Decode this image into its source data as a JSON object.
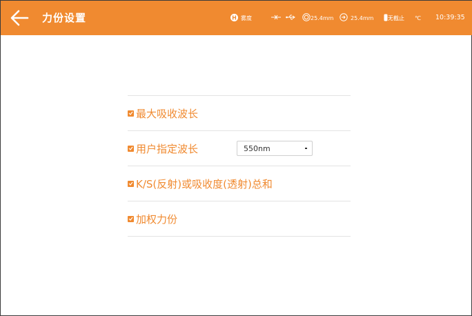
{
  "header": {
    "title": "力份设置",
    "status": {
      "h_badge": "H",
      "mode_text": "雾度",
      "aperture_1": "25.4mm",
      "aperture_2": "25.4mm",
      "trap_text": "无截止",
      "temp_unit": "℃",
      "time": "10:39:35"
    }
  },
  "settings": {
    "items": [
      {
        "label": "最大吸收波长",
        "checked": true
      },
      {
        "label": "用户指定波长",
        "checked": true
      },
      {
        "label": "K/S(反射)或吸收度(透射)总和",
        "checked": true
      },
      {
        "label": "加权力份",
        "checked": true
      }
    ],
    "wavelength_select": {
      "value": "550nm"
    }
  },
  "colors": {
    "accent": "#f08a30",
    "divider": "#e3e3e3"
  }
}
